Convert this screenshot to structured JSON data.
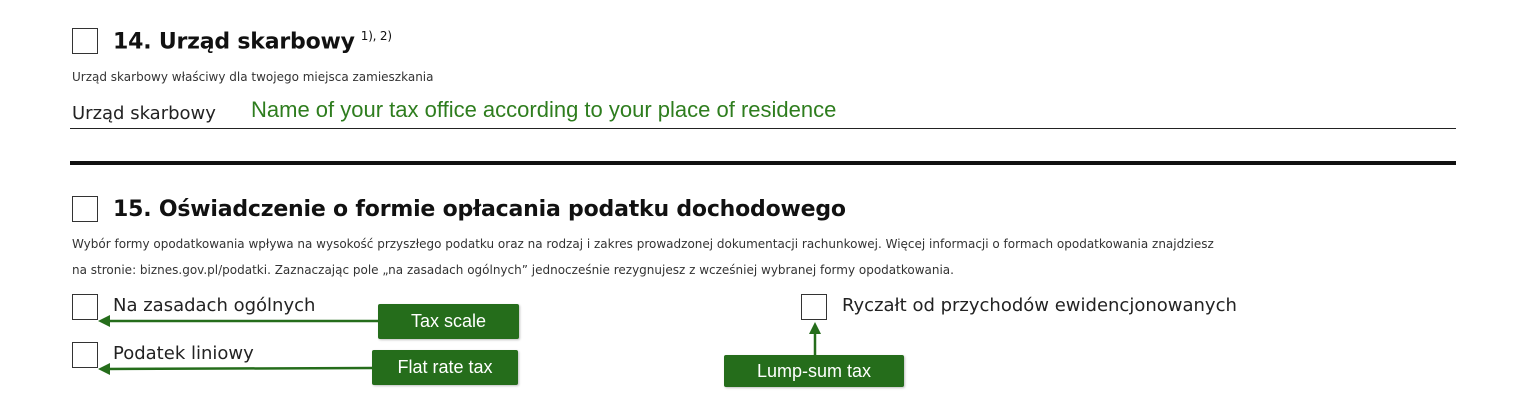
{
  "section14": {
    "title": "14. Urząd skarbowy",
    "footnote": "1), 2)",
    "description": "Urząd skarbowy właściwy dla twojego miejsca zamieszkania",
    "field_label": "Urząd skarbowy",
    "field_value": "Name of your tax office according to your place of residence"
  },
  "section15": {
    "title": "15. Oświadczenie o formie opłacania podatku dochodowego",
    "description_line1": "Wybór formy opodatkowania wpływa na wysokość przyszłego podatku oraz na rodzaj i zakres prowadzonej dokumentacji rachunkowej. Więcej informacji o formach opodatkowania znajdziesz",
    "description_line2": "na stronie: biznes.gov.pl/podatki. Zaznaczając pole „na zasadach ogólnych” jednocześnie rezygnujesz z wcześniej wybranej formy opodatkowania.",
    "options": [
      {
        "label": "Na zasadach ogólnych",
        "annotation": "Tax scale"
      },
      {
        "label": "Podatek liniowy",
        "annotation": "Flat rate tax"
      },
      {
        "label": "Ryczałt od przychodów ewidencjonowanych",
        "annotation": "Lump-sum tax"
      }
    ]
  },
  "colors": {
    "accent_green": "#256d1b",
    "value_green": "#2e7d1e"
  }
}
